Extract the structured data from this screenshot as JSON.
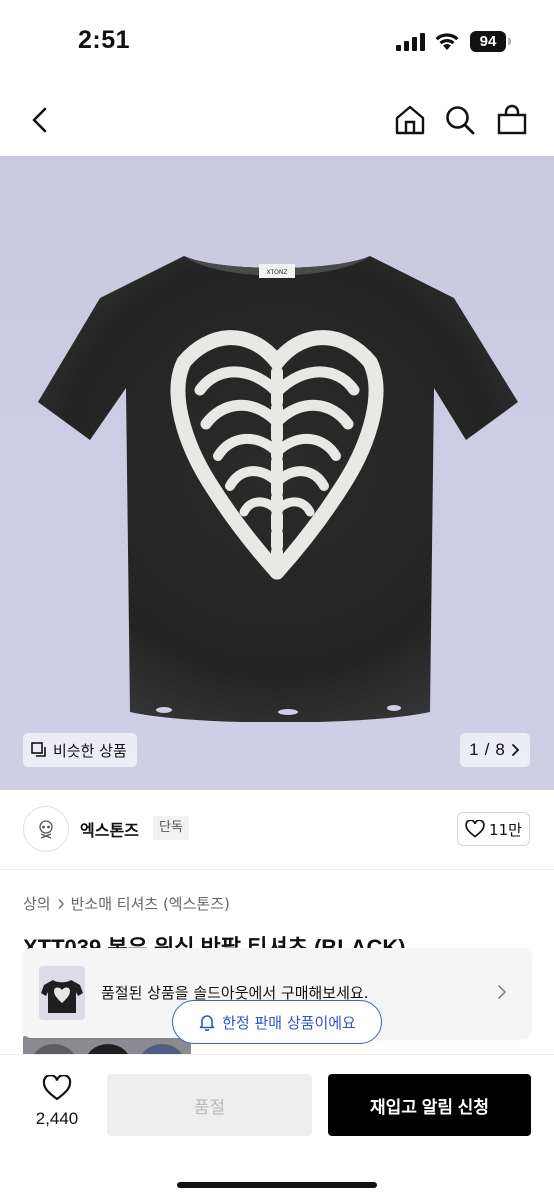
{
  "status_bar": {
    "time": "2:51",
    "battery": "94"
  },
  "nav": {
    "icons": [
      "back-icon",
      "home-icon",
      "search-icon",
      "shopping-bag-icon"
    ]
  },
  "hero": {
    "similar_label": "비슷한 상품",
    "pager": {
      "current": "1",
      "separator": "/",
      "total": "8"
    },
    "shirt_brand_tag": "XTONZ"
  },
  "store": {
    "name": "엑스톤즈",
    "badge": "단독",
    "likes": "11만"
  },
  "breadcrumb": {
    "items": [
      "상의",
      "반소매 티셔츠 (엑스톤즈)"
    ]
  },
  "product": {
    "title": "XTT039 본우 워싱 반팔 티셔츠 (BLACK)"
  },
  "soldout_banner": {
    "text": "품절된 상품을 솔드아웃에서 구매해보세요."
  },
  "limited_badge": {
    "text": "한정 판매 상품이에요"
  },
  "bottom_bar": {
    "wish_count": "2,440",
    "soldout_label": "품절",
    "restock_label": "재입고 알림 신청"
  },
  "colors": {
    "accent_blue": "#2f55d4",
    "hero_bg": "#cacae0",
    "primary_button": "#000000"
  }
}
